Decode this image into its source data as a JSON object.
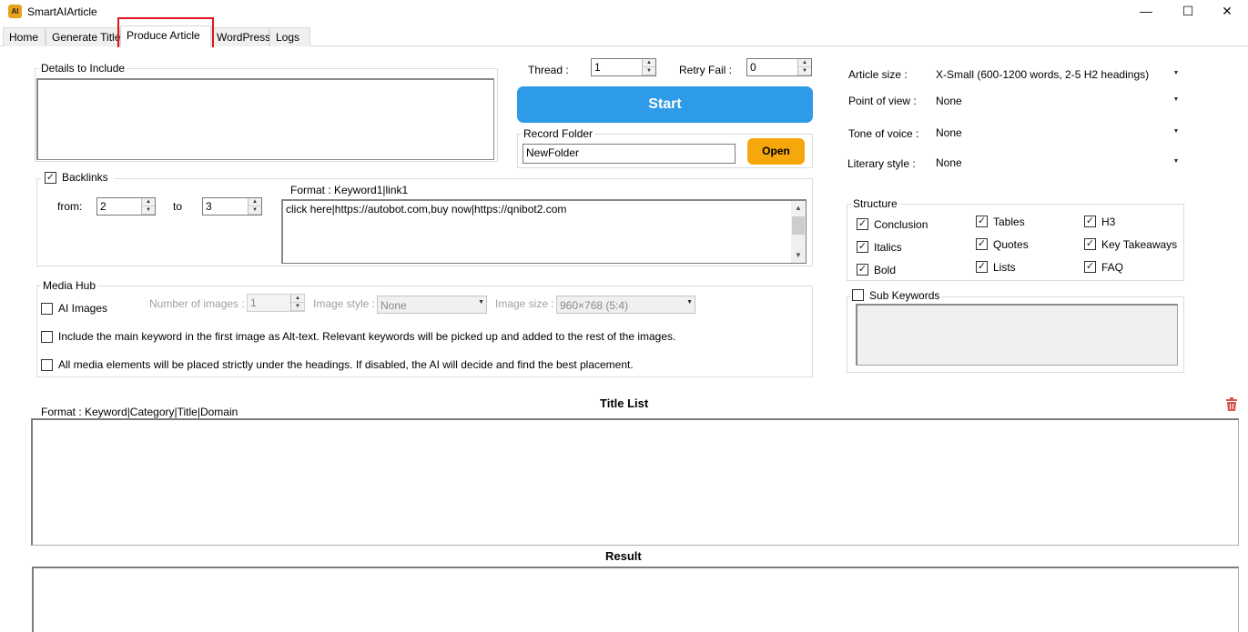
{
  "window": {
    "app_icon_text": "AI",
    "title": "SmartAIArticle",
    "minimize_glyph": "—",
    "maximize_glyph": "☐",
    "close_glyph": "✕"
  },
  "tabs": [
    {
      "label": "Home"
    },
    {
      "label": "Generate Title"
    },
    {
      "label": "Produce Article",
      "active": true
    },
    {
      "label": "WordPress"
    },
    {
      "label": "Logs"
    }
  ],
  "details": {
    "legend": "Details to Include",
    "value": ""
  },
  "thread": {
    "label": "Thread :",
    "value": "1"
  },
  "retry": {
    "label": "Retry Fail :",
    "value": "0"
  },
  "start_label": "Start",
  "record_folder": {
    "legend": "Record Folder",
    "value": "NewFolder",
    "open_label": "Open"
  },
  "backlinks": {
    "label": "Backlinks",
    "checked": true,
    "from_label": "from:",
    "from_value": "2",
    "to_label": "to",
    "to_value": "3",
    "format_label": "Format : Keyword1|link1",
    "value": "click here|https://autobot.com,buy now|https://qnibot2.com"
  },
  "media_hub": {
    "legend": "Media Hub",
    "ai_images_label": "AI Images",
    "num_images_label": "Number of images :",
    "num_images_value": "1",
    "image_style_label": "Image style :",
    "image_style_value": "None",
    "image_size_label": "Image size :",
    "image_size_value": "960×768 (5:4)",
    "alt_text_label": "Include the main keyword in the first image as Alt-text. Relevant keywords will be picked up and added to the rest of the images.",
    "placement_label": "All media elements will be placed strictly under the headings. If disabled, the AI will decide and find the best placement."
  },
  "settings": {
    "article_size_label": "Article size :",
    "article_size_value": "X-Small (600-1200 words, 2-5 H2 headings)",
    "pov_label": "Point of view :",
    "pov_value": "None",
    "tone_label": "Tone of voice :",
    "tone_value": "None",
    "literary_label": "Literary style :",
    "literary_value": "None"
  },
  "structure": {
    "legend": "Structure",
    "items": [
      {
        "label": "Conclusion",
        "checked": true
      },
      {
        "label": "Tables",
        "checked": true
      },
      {
        "label": "H3",
        "checked": true
      },
      {
        "label": "Italics",
        "checked": true
      },
      {
        "label": "Quotes",
        "checked": true
      },
      {
        "label": "Key Takeaways",
        "checked": true
      },
      {
        "label": "Bold",
        "checked": true
      },
      {
        "label": "Lists",
        "checked": true
      },
      {
        "label": "FAQ",
        "checked": true
      }
    ]
  },
  "sub_keywords": {
    "label": "Sub Keywords",
    "checked": false
  },
  "title_list": {
    "title": "Title List",
    "format_label": "Format : Keyword|Category|Title|Domain"
  },
  "result": {
    "title": "Result"
  },
  "colors": {
    "accent": "#2d9be7",
    "open_button": "#f5a70c",
    "highlight": "#e0141e",
    "trash": "#d9534f"
  },
  "icons": {
    "check": "✓",
    "spin_up": "▲",
    "spin_down": "▼",
    "dropdown": "▼",
    "trash": "trash-icon"
  }
}
